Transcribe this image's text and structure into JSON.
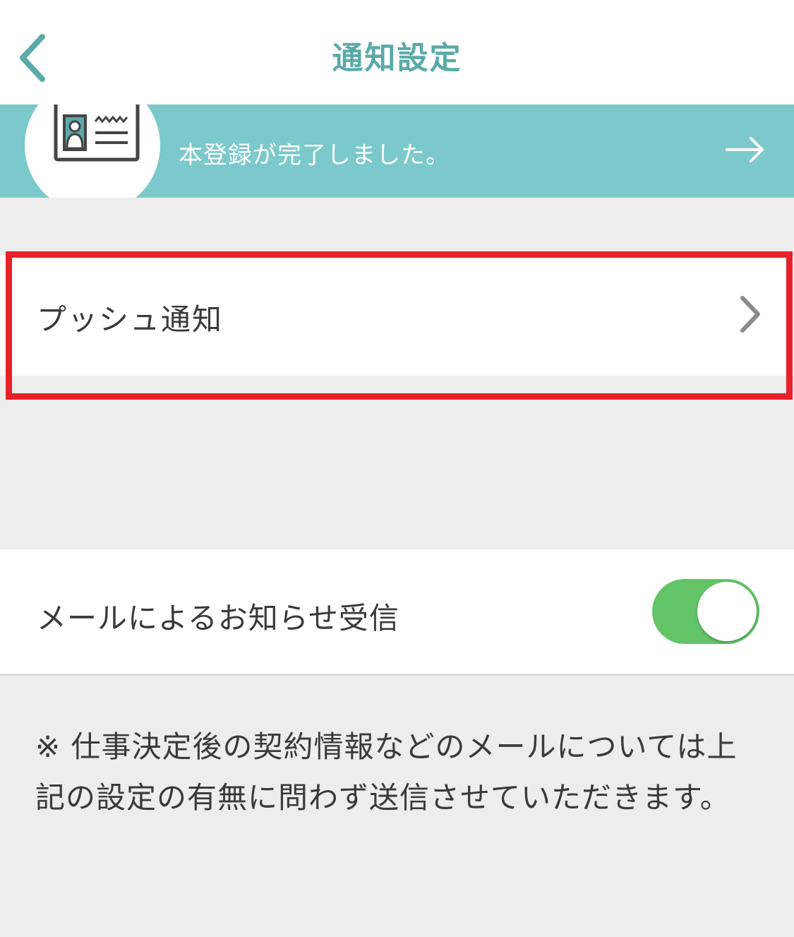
{
  "header": {
    "title": "通知設定",
    "back_icon": "chevron-left-icon",
    "accent_color": "#5aaaa8"
  },
  "banner": {
    "text": "本登録が完了しました。",
    "icon": "id-card-icon",
    "arrow_icon": "arrow-right-icon",
    "background_color": "#7bc9cb"
  },
  "push_notification": {
    "label": "プッシュ通知",
    "chevron_icon": "chevron-right-icon",
    "highlight_color": "#e8212a"
  },
  "email_notification": {
    "label": "メールによるお知らせ受信",
    "toggle_on": true,
    "toggle_color": "#62c466"
  },
  "note": {
    "text": "※ 仕事決定後の契約情報などのメールについては上記の設定の有無に問わず送信させていただきます。"
  }
}
